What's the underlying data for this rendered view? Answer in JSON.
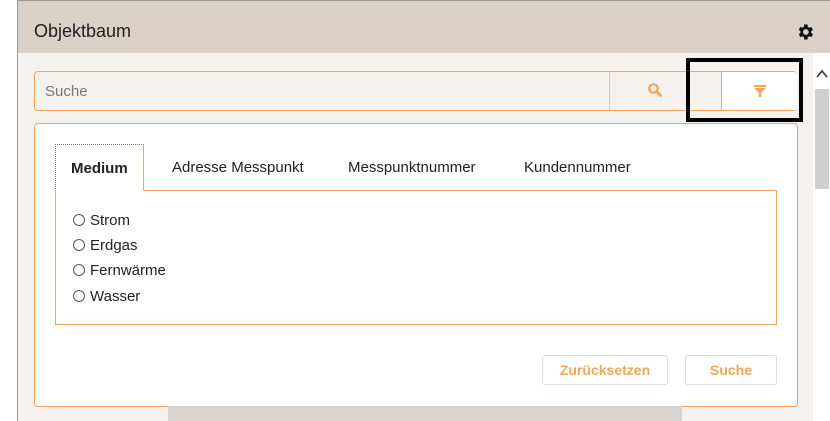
{
  "header": {
    "title": "Objektbaum",
    "settings_icon": "gear-icon"
  },
  "search": {
    "placeholder": "Suche",
    "search_icon": "search-icon",
    "filter_icon": "filter-icon"
  },
  "filter": {
    "tabs": [
      {
        "label": "Medium",
        "active": true
      },
      {
        "label": "Adresse Messpunkt",
        "active": false
      },
      {
        "label": "Messpunktnummer",
        "active": false
      },
      {
        "label": "Kundennummer",
        "active": false
      }
    ],
    "options": [
      {
        "label": "Strom",
        "selected": false
      },
      {
        "label": "Erdgas",
        "selected": false
      },
      {
        "label": "Fernwärme",
        "selected": false
      },
      {
        "label": "Wasser",
        "selected": false
      }
    ],
    "reset_label": "Zurücksetzen",
    "search_label": "Suche"
  },
  "colors": {
    "accent": "#f0a65a",
    "header_bg": "#d9d0c8",
    "panel_bg": "#f4f1ee",
    "highlight": "#000000"
  }
}
